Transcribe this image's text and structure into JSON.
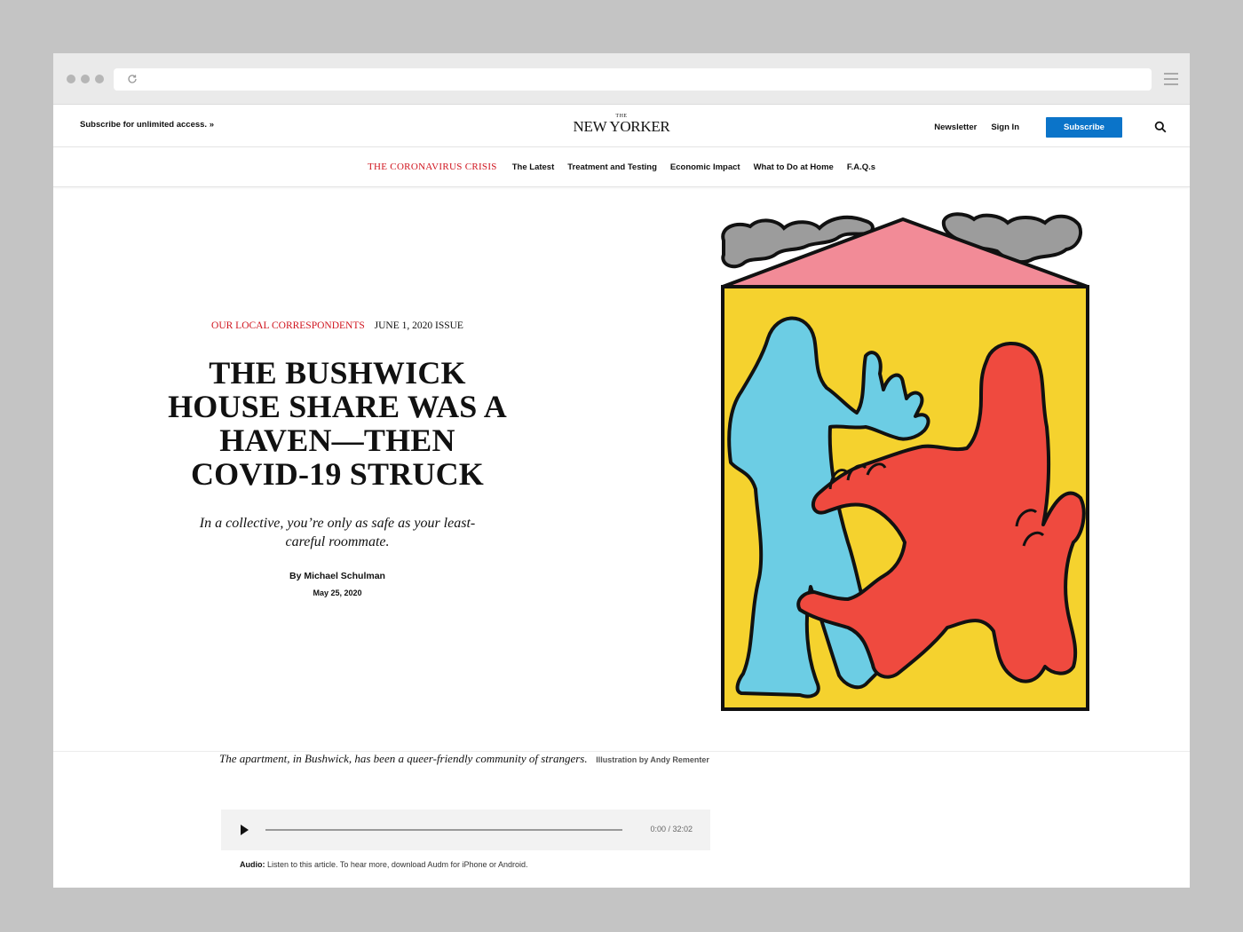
{
  "browser": {
    "url": ""
  },
  "topbar": {
    "promo": "Subscribe for unlimited access. »",
    "logo_the": "THE",
    "logo_main": "NEW YORKER",
    "newsletter": "Newsletter",
    "sign_in": "Sign In",
    "subscribe": "Subscribe"
  },
  "section_nav": {
    "title": "The Coronavirus Crisis",
    "items": [
      {
        "label": "The Latest"
      },
      {
        "label": "Treatment and Testing"
      },
      {
        "label": "Economic Impact"
      },
      {
        "label": "What to Do at Home"
      },
      {
        "label": "F.A.Q.s"
      }
    ]
  },
  "article": {
    "rubric": "Our Local Correspondents",
    "issue": "June 1, 2020 Issue",
    "headline": "The Bushwick House Share Was a Haven—Then COVID-19 Struck",
    "dek": "In a collective, you’re only as safe as your least-careful roommate.",
    "byline": "By Michael Schulman",
    "date": "May 25, 2020",
    "caption": "The apartment, in Bushwick, has been a queer-friendly community of strangers.",
    "credit": "Illustration by Andy Rementer"
  },
  "audio": {
    "time": "0:00 / 32:02",
    "note_label": "Audio:",
    "note_text": " Listen to this article. To hear more, download Audm for iPhone or Android."
  },
  "colors": {
    "accent_red": "#d0151f",
    "subscribe_blue": "#0b74c9",
    "house_yellow": "#f5d22e",
    "roof_pink": "#f28b97",
    "figure_blue": "#6ccde4",
    "figure_red": "#ef4a3f",
    "smoke_gray": "#9c9c9c"
  }
}
